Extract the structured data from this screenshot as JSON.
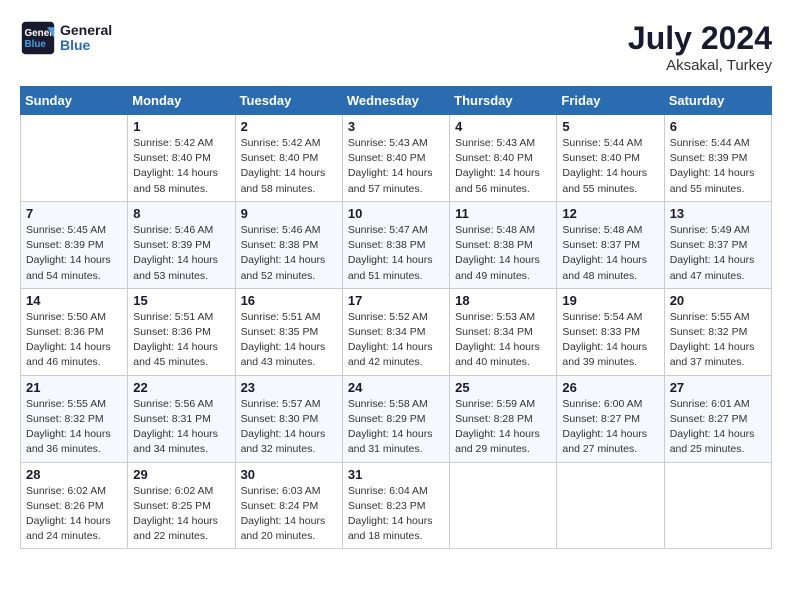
{
  "logo": {
    "line1": "General",
    "line2": "Blue"
  },
  "title": "July 2024",
  "location": "Aksakal, Turkey",
  "days_header": [
    "Sunday",
    "Monday",
    "Tuesday",
    "Wednesday",
    "Thursday",
    "Friday",
    "Saturday"
  ],
  "weeks": [
    [
      {
        "day": "",
        "text": ""
      },
      {
        "day": "1",
        "text": "Sunrise: 5:42 AM\nSunset: 8:40 PM\nDaylight: 14 hours\nand 58 minutes."
      },
      {
        "day": "2",
        "text": "Sunrise: 5:42 AM\nSunset: 8:40 PM\nDaylight: 14 hours\nand 58 minutes."
      },
      {
        "day": "3",
        "text": "Sunrise: 5:43 AM\nSunset: 8:40 PM\nDaylight: 14 hours\nand 57 minutes."
      },
      {
        "day": "4",
        "text": "Sunrise: 5:43 AM\nSunset: 8:40 PM\nDaylight: 14 hours\nand 56 minutes."
      },
      {
        "day": "5",
        "text": "Sunrise: 5:44 AM\nSunset: 8:40 PM\nDaylight: 14 hours\nand 55 minutes."
      },
      {
        "day": "6",
        "text": "Sunrise: 5:44 AM\nSunset: 8:39 PM\nDaylight: 14 hours\nand 55 minutes."
      }
    ],
    [
      {
        "day": "7",
        "text": "Sunrise: 5:45 AM\nSunset: 8:39 PM\nDaylight: 14 hours\nand 54 minutes."
      },
      {
        "day": "8",
        "text": "Sunrise: 5:46 AM\nSunset: 8:39 PM\nDaylight: 14 hours\nand 53 minutes."
      },
      {
        "day": "9",
        "text": "Sunrise: 5:46 AM\nSunset: 8:38 PM\nDaylight: 14 hours\nand 52 minutes."
      },
      {
        "day": "10",
        "text": "Sunrise: 5:47 AM\nSunset: 8:38 PM\nDaylight: 14 hours\nand 51 minutes."
      },
      {
        "day": "11",
        "text": "Sunrise: 5:48 AM\nSunset: 8:38 PM\nDaylight: 14 hours\nand 49 minutes."
      },
      {
        "day": "12",
        "text": "Sunrise: 5:48 AM\nSunset: 8:37 PM\nDaylight: 14 hours\nand 48 minutes."
      },
      {
        "day": "13",
        "text": "Sunrise: 5:49 AM\nSunset: 8:37 PM\nDaylight: 14 hours\nand 47 minutes."
      }
    ],
    [
      {
        "day": "14",
        "text": "Sunrise: 5:50 AM\nSunset: 8:36 PM\nDaylight: 14 hours\nand 46 minutes."
      },
      {
        "day": "15",
        "text": "Sunrise: 5:51 AM\nSunset: 8:36 PM\nDaylight: 14 hours\nand 45 minutes."
      },
      {
        "day": "16",
        "text": "Sunrise: 5:51 AM\nSunset: 8:35 PM\nDaylight: 14 hours\nand 43 minutes."
      },
      {
        "day": "17",
        "text": "Sunrise: 5:52 AM\nSunset: 8:34 PM\nDaylight: 14 hours\nand 42 minutes."
      },
      {
        "day": "18",
        "text": "Sunrise: 5:53 AM\nSunset: 8:34 PM\nDaylight: 14 hours\nand 40 minutes."
      },
      {
        "day": "19",
        "text": "Sunrise: 5:54 AM\nSunset: 8:33 PM\nDaylight: 14 hours\nand 39 minutes."
      },
      {
        "day": "20",
        "text": "Sunrise: 5:55 AM\nSunset: 8:32 PM\nDaylight: 14 hours\nand 37 minutes."
      }
    ],
    [
      {
        "day": "21",
        "text": "Sunrise: 5:55 AM\nSunset: 8:32 PM\nDaylight: 14 hours\nand 36 minutes."
      },
      {
        "day": "22",
        "text": "Sunrise: 5:56 AM\nSunset: 8:31 PM\nDaylight: 14 hours\nand 34 minutes."
      },
      {
        "day": "23",
        "text": "Sunrise: 5:57 AM\nSunset: 8:30 PM\nDaylight: 14 hours\nand 32 minutes."
      },
      {
        "day": "24",
        "text": "Sunrise: 5:58 AM\nSunset: 8:29 PM\nDaylight: 14 hours\nand 31 minutes."
      },
      {
        "day": "25",
        "text": "Sunrise: 5:59 AM\nSunset: 8:28 PM\nDaylight: 14 hours\nand 29 minutes."
      },
      {
        "day": "26",
        "text": "Sunrise: 6:00 AM\nSunset: 8:27 PM\nDaylight: 14 hours\nand 27 minutes."
      },
      {
        "day": "27",
        "text": "Sunrise: 6:01 AM\nSunset: 8:27 PM\nDaylight: 14 hours\nand 25 minutes."
      }
    ],
    [
      {
        "day": "28",
        "text": "Sunrise: 6:02 AM\nSunset: 8:26 PM\nDaylight: 14 hours\nand 24 minutes."
      },
      {
        "day": "29",
        "text": "Sunrise: 6:02 AM\nSunset: 8:25 PM\nDaylight: 14 hours\nand 22 minutes."
      },
      {
        "day": "30",
        "text": "Sunrise: 6:03 AM\nSunset: 8:24 PM\nDaylight: 14 hours\nand 20 minutes."
      },
      {
        "day": "31",
        "text": "Sunrise: 6:04 AM\nSunset: 8:23 PM\nDaylight: 14 hours\nand 18 minutes."
      },
      {
        "day": "",
        "text": ""
      },
      {
        "day": "",
        "text": ""
      },
      {
        "day": "",
        "text": ""
      }
    ]
  ]
}
